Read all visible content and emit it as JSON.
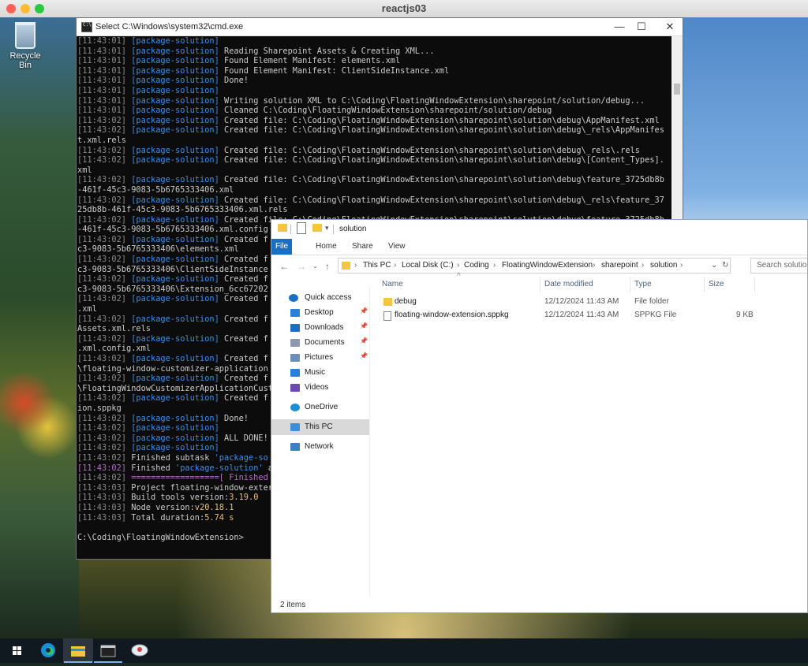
{
  "mac": {
    "title": "reactjs03"
  },
  "desktop": {
    "recycle_bin": "Recycle Bin"
  },
  "cmd": {
    "title": "Select C:\\Windows\\system32\\cmd.exe",
    "ctl_min": "—",
    "ctl_max": "☐",
    "ctl_close": "✕",
    "lines": [
      [
        [
          "ts",
          "[11:43:01] "
        ],
        [
          "tag",
          "[package-solution]"
        ]
      ],
      [
        [
          "ts",
          "[11:43:01] "
        ],
        [
          "tag",
          "[package-solution]"
        ],
        [
          "txt",
          " Reading Sharepoint Assets & Creating XML..."
        ]
      ],
      [
        [
          "ts",
          "[11:43:01] "
        ],
        [
          "tag",
          "[package-solution]"
        ],
        [
          "txt",
          " Found Element Manifest: elements.xml"
        ]
      ],
      [
        [
          "ts",
          "[11:43:01] "
        ],
        [
          "tag",
          "[package-solution]"
        ],
        [
          "txt",
          " Found Element Manifest: ClientSideInstance.xml"
        ]
      ],
      [
        [
          "ts",
          "[11:43:01] "
        ],
        [
          "tag",
          "[package-solution]"
        ],
        [
          "txt",
          " Done!"
        ]
      ],
      [
        [
          "ts",
          "[11:43:01] "
        ],
        [
          "tag",
          "[package-solution]"
        ]
      ],
      [
        [
          "ts",
          "[11:43:01] "
        ],
        [
          "tag",
          "[package-solution]"
        ],
        [
          "txt",
          " Writing solution XML to C:\\Coding\\FloatingWindowExtension\\sharepoint/solution/debug..."
        ]
      ],
      [
        [
          "ts",
          "[11:43:01] "
        ],
        [
          "tag",
          "[package-solution]"
        ],
        [
          "txt",
          " Cleaned C:\\Coding\\FloatingWindowExtension\\sharepoint/solution/debug"
        ]
      ],
      [
        [
          "ts",
          "[11:43:02] "
        ],
        [
          "tag",
          "[package-solution]"
        ],
        [
          "txt",
          " Created file: C:\\Coding\\FloatingWindowExtension\\sharepoint\\solution\\debug\\AppManifest.xml"
        ]
      ],
      [
        [
          "ts",
          "[11:43:02] "
        ],
        [
          "tag",
          "[package-solution]"
        ],
        [
          "txt",
          " Created file: C:\\Coding\\FloatingWindowExtension\\sharepoint\\solution\\debug\\_rels\\AppManifes"
        ]
      ],
      [
        [
          "txt",
          "t.xml.rels"
        ]
      ],
      [
        [
          "ts",
          "[11:43:02] "
        ],
        [
          "tag",
          "[package-solution]"
        ],
        [
          "txt",
          " Created file: C:\\Coding\\FloatingWindowExtension\\sharepoint\\solution\\debug\\_rels\\.rels"
        ]
      ],
      [
        [
          "ts",
          "[11:43:02] "
        ],
        [
          "tag",
          "[package-solution]"
        ],
        [
          "txt",
          " Created file: C:\\Coding\\FloatingWindowExtension\\sharepoint\\solution\\debug\\[Content_Types]."
        ]
      ],
      [
        [
          "txt",
          "xml"
        ]
      ],
      [
        [
          "ts",
          "[11:43:02] "
        ],
        [
          "tag",
          "[package-solution]"
        ],
        [
          "txt",
          " Created file: C:\\Coding\\FloatingWindowExtension\\sharepoint\\solution\\debug\\feature_3725db8b"
        ]
      ],
      [
        [
          "txt",
          "-461f-45c3-9083-5b6765333406.xml"
        ]
      ],
      [
        [
          "ts",
          "[11:43:02] "
        ],
        [
          "tag",
          "[package-solution]"
        ],
        [
          "txt",
          " Created file: C:\\Coding\\FloatingWindowExtension\\sharepoint\\solution\\debug\\_rels\\feature_37"
        ]
      ],
      [
        [
          "txt",
          "25db8b-461f-45c3-9083-5b6765333406.xml.rels"
        ]
      ],
      [
        [
          "ts",
          "[11:43:02] "
        ],
        [
          "tag",
          "[package-solution]"
        ],
        [
          "txt",
          " Created file: C:\\Coding\\FloatingWindowExtension\\sharepoint\\solution\\debug\\feature_3725db8b"
        ]
      ],
      [
        [
          "txt",
          "-461f-45c3-9083-5b6765333406.xml.config"
        ]
      ],
      [
        [
          "ts",
          "[11:43:02] "
        ],
        [
          "tag",
          "[package-solution]"
        ],
        [
          "txt",
          " Created f"
        ]
      ],
      [
        [
          "txt",
          "c3-9083-5b6765333406\\elements.xml"
        ]
      ],
      [
        [
          "ts",
          "[11:43:02] "
        ],
        [
          "tag",
          "[package-solution]"
        ],
        [
          "txt",
          " Created f"
        ]
      ],
      [
        [
          "txt",
          "c3-9083-5b6765333406\\ClientSideInstance"
        ]
      ],
      [
        [
          "ts",
          "[11:43:02] "
        ],
        [
          "tag",
          "[package-solution]"
        ],
        [
          "txt",
          " Created f"
        ]
      ],
      [
        [
          "txt",
          "c3-9083-5b6765333406\\Extension_6cc67202"
        ]
      ],
      [
        [
          "ts",
          "[11:43:02] "
        ],
        [
          "tag",
          "[package-solution]"
        ],
        [
          "txt",
          " Created f"
        ]
      ],
      [
        [
          "txt",
          ".xml"
        ]
      ],
      [
        [
          "ts",
          "[11:43:02] "
        ],
        [
          "tag",
          "[package-solution]"
        ],
        [
          "txt",
          " Created f"
        ]
      ],
      [
        [
          "txt",
          "Assets.xml.rels"
        ]
      ],
      [
        [
          "ts",
          "[11:43:02] "
        ],
        [
          "tag",
          "[package-solution]"
        ],
        [
          "txt",
          " Created f"
        ]
      ],
      [
        [
          "txt",
          ".xml.config.xml"
        ]
      ],
      [
        [
          "ts",
          "[11:43:02] "
        ],
        [
          "tag",
          "[package-solution]"
        ],
        [
          "txt",
          " Created f"
        ]
      ],
      [
        [
          "txt",
          "\\floating-window-customizer-application"
        ]
      ],
      [
        [
          "ts",
          "[11:43:02] "
        ],
        [
          "tag",
          "[package-solution]"
        ],
        [
          "txt",
          " Created f"
        ]
      ],
      [
        [
          "txt",
          "\\FloatingWindowCustomizerApplicationCust"
        ]
      ],
      [
        [
          "ts",
          "[11:43:02] "
        ],
        [
          "tag",
          "[package-solution]"
        ],
        [
          "txt",
          " Created f"
        ]
      ],
      [
        [
          "txt",
          "ion.sppkg"
        ]
      ],
      [
        [
          "ts",
          "[11:43:02] "
        ],
        [
          "tag",
          "[package-solution]"
        ],
        [
          "txt",
          " Done!"
        ]
      ],
      [
        [
          "ts",
          "[11:43:02] "
        ],
        [
          "tag",
          "[package-solution]"
        ]
      ],
      [
        [
          "ts",
          "[11:43:02] "
        ],
        [
          "tag",
          "[package-solution]"
        ],
        [
          "txt",
          " ALL DONE!"
        ]
      ],
      [
        [
          "ts",
          "[11:43:02] "
        ],
        [
          "tag",
          "[package-solution]"
        ]
      ],
      [
        [
          "ts",
          "[11:43:02] "
        ],
        [
          "txt",
          "Finished subtask "
        ],
        [
          "tag",
          "'package-so"
        ]
      ],
      [
        [
          "tsm",
          "[11:43:02] "
        ],
        [
          "txt",
          "Finished "
        ],
        [
          "tag",
          "'package-solution'"
        ],
        [
          "txt",
          " a"
        ]
      ],
      [
        [
          "ts",
          "[11:43:02] "
        ],
        [
          "eq",
          "==================[ Finished"
        ]
      ],
      [
        [
          "ts",
          "[11:43:03] "
        ],
        [
          "txt",
          "Project floating-window-exter"
        ]
      ],
      [
        [
          "ts",
          "[11:43:03] "
        ],
        [
          "txt",
          "Build tools version:"
        ],
        [
          "num",
          "3.19.0"
        ]
      ],
      [
        [
          "ts",
          "[11:43:03] "
        ],
        [
          "txt",
          "Node version:"
        ],
        [
          "num",
          "v20.18.1"
        ]
      ],
      [
        [
          "ts",
          "[11:43:03] "
        ],
        [
          "txt",
          "Total duration:"
        ],
        [
          "num",
          "5.74 s"
        ]
      ],
      [
        [
          "txt",
          ""
        ]
      ],
      [
        [
          "txt",
          "C:\\Coding\\FloatingWindowExtension>"
        ]
      ]
    ]
  },
  "explorer": {
    "title": "solution",
    "tabs": [
      "File",
      "Home",
      "Share",
      "View"
    ],
    "breadcrumb": [
      "This PC",
      "Local Disk (C:)",
      "Coding",
      "FloatingWindowExtension",
      "sharepoint",
      "solution"
    ],
    "search_placeholder": "Search solution",
    "nav": [
      {
        "label": "Quick access",
        "icon": "star-icon",
        "pinned": false
      },
      {
        "label": "Desktop",
        "icon": "desktop-icon",
        "pinned": true
      },
      {
        "label": "Downloads",
        "icon": "download-icon",
        "pinned": true
      },
      {
        "label": "Documents",
        "icon": "document-icon",
        "pinned": true
      },
      {
        "label": "Pictures",
        "icon": "picture-icon",
        "pinned": true
      },
      {
        "label": "Music",
        "icon": "music-icon",
        "pinned": false
      },
      {
        "label": "Videos",
        "icon": "video-icon",
        "pinned": false
      },
      {
        "label": "OneDrive",
        "icon": "cloud-icon",
        "pinned": false
      },
      {
        "label": "This PC",
        "icon": "computer-icon",
        "pinned": false
      },
      {
        "label": "Network",
        "icon": "network-icon",
        "pinned": false
      }
    ],
    "columns": {
      "name": "Name",
      "modified": "Date modified",
      "type": "Type",
      "size": "Size"
    },
    "files": [
      {
        "name": "debug",
        "modified": "12/12/2024 11:43 AM",
        "type": "File folder",
        "size": "",
        "icon": "folder-icon"
      },
      {
        "name": "floating-window-extension.sppkg",
        "modified": "12/12/2024 11:43 AM",
        "type": "SPPKG File",
        "size": "9 KB",
        "icon": "file-icon"
      }
    ],
    "status": "2 items"
  },
  "colors": {
    "accent": "#1a6fc4",
    "folder": "#f5c542",
    "console_tag": "#3b8eea",
    "console_num": "#e5c07b"
  }
}
